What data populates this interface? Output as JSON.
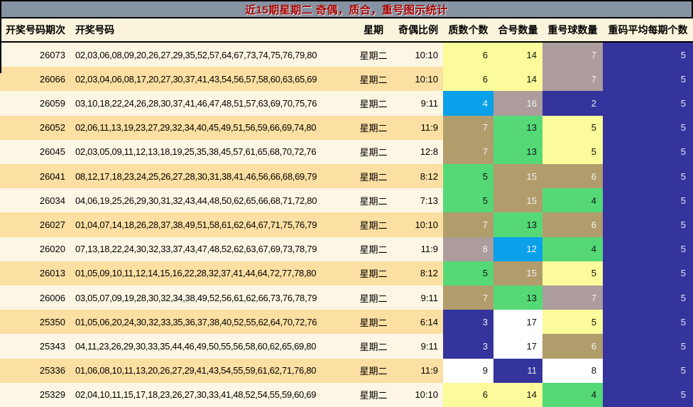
{
  "title": "近15期星期二 奇偶，质合，重号图示统计",
  "header": {
    "period": "开奖号码期次",
    "numbers": "开奖号码",
    "week": "星期",
    "ratio": "奇偶比例",
    "prime": "质数个数",
    "composite": "合号数量",
    "repeat": "重号球数量",
    "avg": "重码平均每期个数"
  },
  "theme": {
    "title_bg": "#8693A3",
    "title_fg": "#A40000",
    "header_bg": "#FBF4DC",
    "row_light": "#FDF6E4",
    "row_peach": "#FCDFA2"
  },
  "palette": {
    "yellow": {
      "bg": "#FBFB9B",
      "fg": "#111111"
    },
    "green": {
      "bg": "#55D977",
      "fg": "#111111"
    },
    "tan": {
      "bg": "#B19C6C",
      "fg": "#F2F2F2"
    },
    "mauve": {
      "bg": "#AC9C9C",
      "fg": "#F2F2F2"
    },
    "azure": {
      "bg": "#0AA0EA",
      "fg": "#F5F5F5"
    },
    "navy": {
      "bg": "#34349C",
      "fg": "#E9E9F2"
    },
    "white": {
      "bg": "#FFFFFF",
      "fg": "#111111"
    }
  },
  "rows": [
    {
      "period": "26073",
      "numbers": "02,03,06,08,09,20,26,27,29,35,52,57,64,67,73,74,75,76,79,80",
      "week": "星期二",
      "ratio": "10:10",
      "prime": {
        "v": "6",
        "c": "yellow"
      },
      "composite": {
        "v": "14",
        "c": "yellow"
      },
      "repeat": {
        "v": "7",
        "c": "mauve"
      },
      "avg": {
        "v": "5",
        "c": "navy"
      }
    },
    {
      "period": "26066",
      "numbers": "02,03,04,06,08,17,20,27,30,37,41,43,54,56,57,58,60,63,65,69",
      "week": "星期二",
      "ratio": "10:10",
      "prime": {
        "v": "6",
        "c": "yellow"
      },
      "composite": {
        "v": "14",
        "c": "yellow"
      },
      "repeat": {
        "v": "7",
        "c": "mauve"
      },
      "avg": {
        "v": "5",
        "c": "navy"
      }
    },
    {
      "period": "26059",
      "numbers": "03,10,18,22,24,26,28,30,37,41,46,47,48,51,57,63,69,70,75,76",
      "week": "星期二",
      "ratio": "9:11",
      "prime": {
        "v": "4",
        "c": "azure"
      },
      "composite": {
        "v": "16",
        "c": "mauve"
      },
      "repeat": {
        "v": "2",
        "c": "navy"
      },
      "avg": {
        "v": "5",
        "c": "navy"
      }
    },
    {
      "period": "26052",
      "numbers": "02,06,11,13,19,23,27,29,32,34,40,45,49,51,56,59,66,69,74,80",
      "week": "星期二",
      "ratio": "11:9",
      "prime": {
        "v": "7",
        "c": "tan"
      },
      "composite": {
        "v": "13",
        "c": "green"
      },
      "repeat": {
        "v": "5",
        "c": "yellow"
      },
      "avg": {
        "v": "5",
        "c": "navy"
      }
    },
    {
      "period": "26045",
      "numbers": "02,03,05,09,11,12,13,18,19,25,35,38,45,57,61,65,68,70,72,76",
      "week": "星期二",
      "ratio": "12:8",
      "prime": {
        "v": "7",
        "c": "tan"
      },
      "composite": {
        "v": "13",
        "c": "green"
      },
      "repeat": {
        "v": "5",
        "c": "yellow"
      },
      "avg": {
        "v": "5",
        "c": "navy"
      }
    },
    {
      "period": "26041",
      "numbers": "08,12,17,18,23,24,25,26,27,28,30,31,38,41,46,56,66,68,69,79",
      "week": "星期二",
      "ratio": "8:12",
      "prime": {
        "v": "5",
        "c": "green"
      },
      "composite": {
        "v": "15",
        "c": "tan"
      },
      "repeat": {
        "v": "6",
        "c": "tan"
      },
      "avg": {
        "v": "5",
        "c": "navy"
      }
    },
    {
      "period": "26034",
      "numbers": "04,06,19,25,26,29,30,31,32,43,44,48,50,62,65,66,68,71,72,80",
      "week": "星期二",
      "ratio": "7:13",
      "prime": {
        "v": "5",
        "c": "green"
      },
      "composite": {
        "v": "15",
        "c": "tan"
      },
      "repeat": {
        "v": "4",
        "c": "green"
      },
      "avg": {
        "v": "5",
        "c": "navy"
      }
    },
    {
      "period": "26027",
      "numbers": "01,04,07,14,18,26,28,37,38,49,51,58,61,62,64,67,71,75,76,79",
      "week": "星期二",
      "ratio": "10:10",
      "prime": {
        "v": "7",
        "c": "tan"
      },
      "composite": {
        "v": "13",
        "c": "green"
      },
      "repeat": {
        "v": "6",
        "c": "tan"
      },
      "avg": {
        "v": "5",
        "c": "navy"
      }
    },
    {
      "period": "26020",
      "numbers": "07,13,18,22,24,30,32,33,37,43,47,48,52,62,63,67,69,73,78,79",
      "week": "星期二",
      "ratio": "11:9",
      "prime": {
        "v": "8",
        "c": "mauve"
      },
      "composite": {
        "v": "12",
        "c": "azure"
      },
      "repeat": {
        "v": "4",
        "c": "green"
      },
      "avg": {
        "v": "5",
        "c": "navy"
      }
    },
    {
      "period": "26013",
      "numbers": "01,05,09,10,11,12,14,15,16,22,28,32,37,41,44,64,72,77,78,80",
      "week": "星期二",
      "ratio": "8:12",
      "prime": {
        "v": "5",
        "c": "green"
      },
      "composite": {
        "v": "15",
        "c": "tan"
      },
      "repeat": {
        "v": "5",
        "c": "yellow"
      },
      "avg": {
        "v": "5",
        "c": "navy"
      }
    },
    {
      "period": "26006",
      "numbers": "03,05,07,09,19,28,30,32,34,38,49,52,56,61,62,66,73,76,78,79",
      "week": "星期二",
      "ratio": "9:11",
      "prime": {
        "v": "7",
        "c": "tan"
      },
      "composite": {
        "v": "13",
        "c": "green"
      },
      "repeat": {
        "v": "7",
        "c": "mauve"
      },
      "avg": {
        "v": "5",
        "c": "navy"
      }
    },
    {
      "period": "25350",
      "numbers": "01,05,06,20,24,30,32,33,35,36,37,38,40,52,55,62,64,70,72,76",
      "week": "星期二",
      "ratio": "6:14",
      "prime": {
        "v": "3",
        "c": "navy"
      },
      "composite": {
        "v": "17",
        "c": "white"
      },
      "repeat": {
        "v": "5",
        "c": "yellow"
      },
      "avg": {
        "v": "5",
        "c": "navy"
      }
    },
    {
      "period": "25343",
      "numbers": "04,11,23,26,29,30,33,35,44,46,49,50,55,56,58,60,62,65,69,80",
      "week": "星期二",
      "ratio": "9:11",
      "prime": {
        "v": "3",
        "c": "navy"
      },
      "composite": {
        "v": "17",
        "c": "white"
      },
      "repeat": {
        "v": "6",
        "c": "tan"
      },
      "avg": {
        "v": "5",
        "c": "navy"
      }
    },
    {
      "period": "25336",
      "numbers": "01,06,08,10,11,13,20,26,27,29,41,43,54,55,59,61,62,71,76,80",
      "week": "星期二",
      "ratio": "11:9",
      "prime": {
        "v": "9",
        "c": "white"
      },
      "composite": {
        "v": "11",
        "c": "navy"
      },
      "repeat": {
        "v": "8",
        "c": "white"
      },
      "avg": {
        "v": "5",
        "c": "navy"
      }
    },
    {
      "period": "25329",
      "numbers": "02,04,10,11,15,17,18,23,26,27,30,33,41,48,52,54,55,59,60,69",
      "week": "星期二",
      "ratio": "10:10",
      "prime": {
        "v": "6",
        "c": "yellow"
      },
      "composite": {
        "v": "14",
        "c": "yellow"
      },
      "repeat": {
        "v": "4",
        "c": "green"
      },
      "avg": {
        "v": "5",
        "c": "navy"
      }
    }
  ]
}
